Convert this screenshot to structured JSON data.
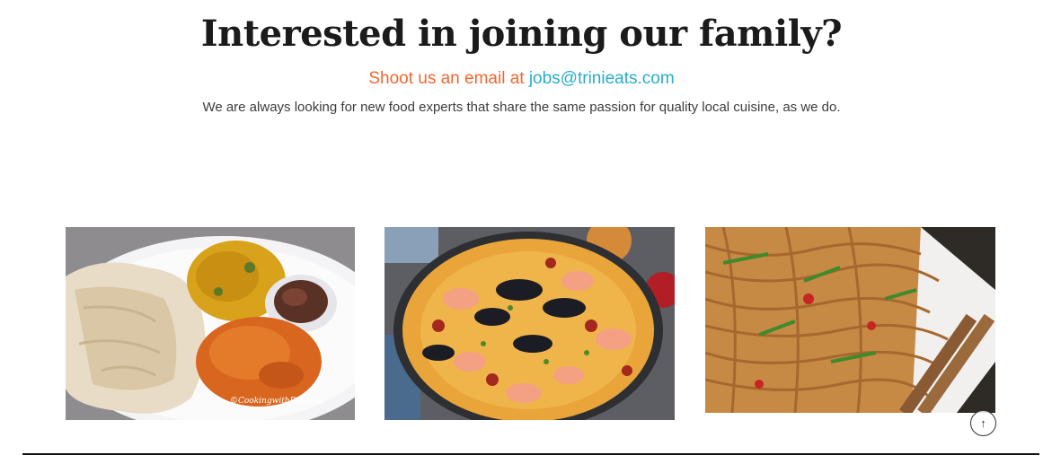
{
  "heading": "Interested in joining our family?",
  "email_line": {
    "prefix": "Shoot us an email at ",
    "email": "jobs@trinieats.com"
  },
  "subtext": "We are always looking for new food experts that share the same passion for quality local cuisine, as we do.",
  "gallery": [
    {
      "watermark": "©CookingwithRia.com"
    }
  ],
  "scroll_top": {
    "icon": "arrow-up-icon",
    "glyph": "↑"
  },
  "colors": {
    "accent_orange": "#f0672f",
    "link_teal": "#26aecb",
    "heading": "#1b1b1b"
  }
}
